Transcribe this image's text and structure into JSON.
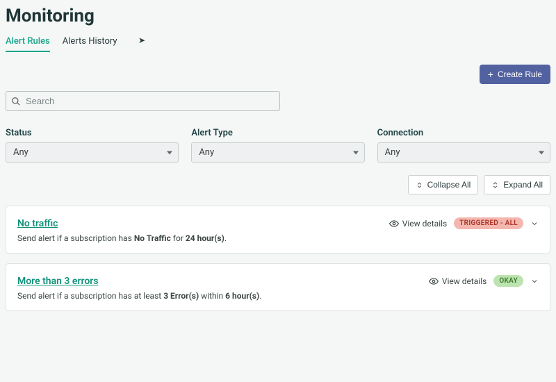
{
  "page_title": "Monitoring",
  "tabs": [
    {
      "label": "Alert Rules",
      "active": true
    },
    {
      "label": "Alerts History",
      "active": false
    }
  ],
  "create_button_label": "Create Rule",
  "search": {
    "placeholder": "Search",
    "value": ""
  },
  "filters": [
    {
      "label": "Status",
      "value": "Any"
    },
    {
      "label": "Alert Type",
      "value": "Any"
    },
    {
      "label": "Connection",
      "value": "Any"
    }
  ],
  "expand_buttons": {
    "collapse": "Collapse All",
    "expand": "Expand All"
  },
  "view_details_label": "View details",
  "rules": [
    {
      "title": "No traffic",
      "desc_prefix": "Send alert if a subscription has ",
      "desc_bold1": "No Traffic",
      "desc_mid": " for ",
      "desc_bold2": "24 hour(s)",
      "desc_suffix": ".",
      "status": "TRIGGERED - ALL",
      "status_kind": "triggered"
    },
    {
      "title": "More than 3 errors",
      "desc_prefix": "Send alert if a subscription has at least ",
      "desc_bold1": "3 Error(s)",
      "desc_mid": " within ",
      "desc_bold2": "6 hour(s)",
      "desc_suffix": ".",
      "status": "OKAY",
      "status_kind": "okay"
    }
  ]
}
